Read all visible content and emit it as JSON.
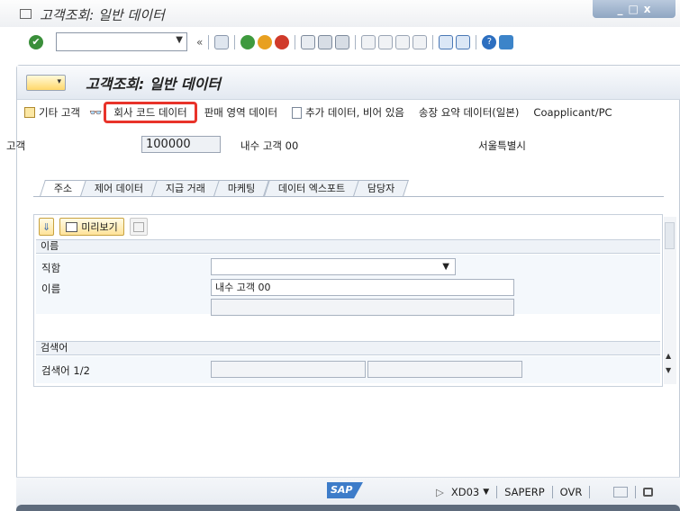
{
  "window": {
    "title": "고객조회: 일반 데이터",
    "controls": [
      "_",
      "□",
      "x"
    ]
  },
  "command": {
    "field_value": "",
    "toolbar_icons": [
      "back-icon",
      "save-icon",
      "back-green-icon",
      "exit-icon",
      "cancel-icon",
      "print-icon",
      "find-icon",
      "find-next-icon",
      "first-page-icon",
      "prev-page-icon",
      "next-page-icon",
      "last-page-icon",
      "new-session-icon",
      "shortcut-icon",
      "help-icon",
      "layout-icon"
    ]
  },
  "app": {
    "title": "고객조회: 일반 데이터",
    "toolbar": [
      {
        "label": "기타 고객",
        "icon": "other-customer-icon"
      },
      {
        "label": "회사 코드 데이터",
        "icon": "glasses-icon",
        "highlighted": true
      },
      {
        "label": "판매 영역 데이터",
        "icon": ""
      },
      {
        "label": "추가 데이터, 비어 있음",
        "icon": "doc-arrow-icon"
      },
      {
        "label": "송장 요약 데이터(일본)",
        "icon": ""
      },
      {
        "label": "Coapplicant/PC",
        "icon": ""
      }
    ]
  },
  "customer": {
    "label": "고객",
    "number": "100000",
    "name": "내수 고객 00",
    "city": "서울특별시"
  },
  "tabs": [
    "주소",
    "제어 데이터",
    "지급 거래",
    "마케팅",
    "데이터 엑스포트",
    "담당자"
  ],
  "active_tab": "주소",
  "panel": {
    "preview_label": "미리보기",
    "name_group": {
      "title": "이름",
      "title_field_label": "직함",
      "title_field_value": "",
      "name_label": "이름",
      "name_value": "내수 고객 00",
      "name2_value": ""
    },
    "search_group": {
      "title": "검색어",
      "label": "검색어 1/2",
      "value1": "",
      "value2": ""
    }
  },
  "status": {
    "brand": "SAP",
    "transaction": "XD03",
    "system": "SAPERP",
    "mode": "OVR"
  }
}
